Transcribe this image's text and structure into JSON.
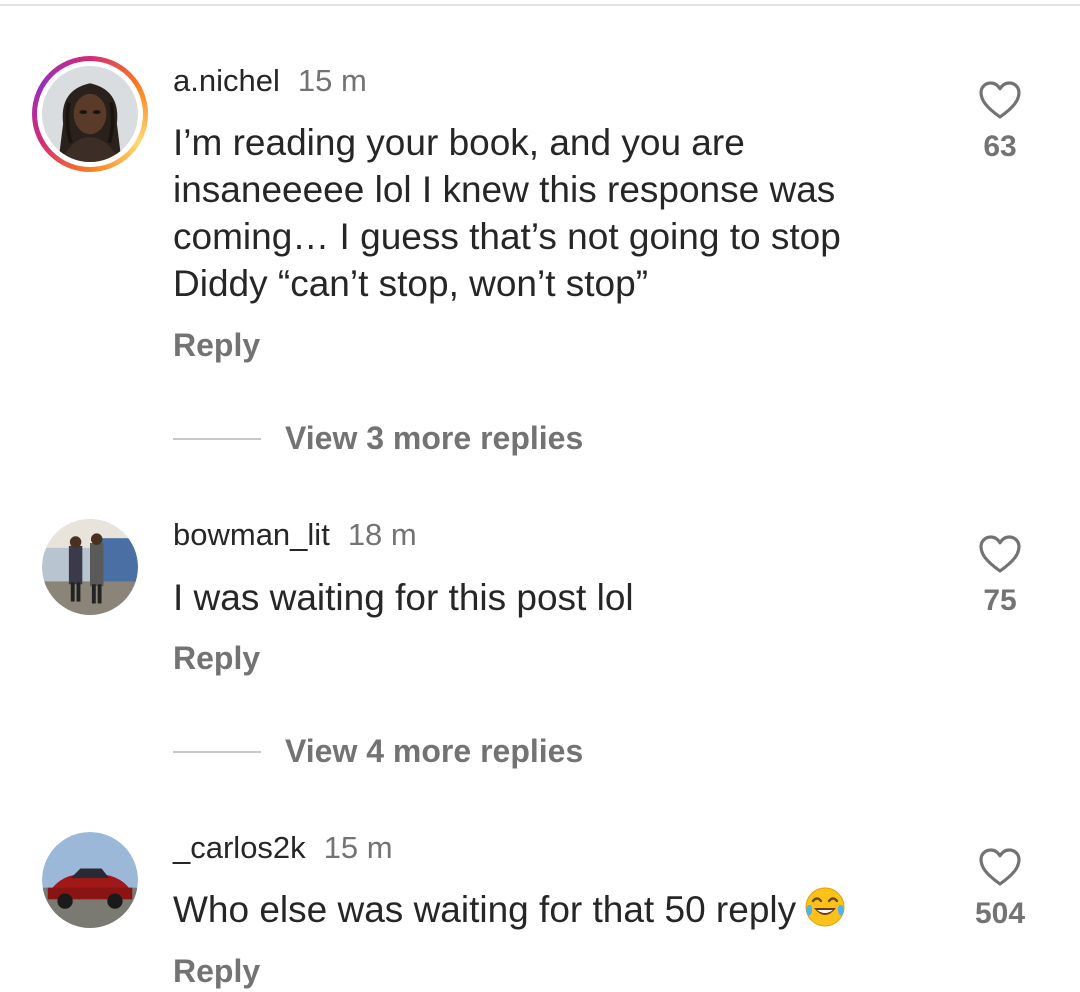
{
  "comments": [
    {
      "username": "a.nichel",
      "time": "15 m",
      "text": "I’m reading your book, and you are insaneeeee lol I knew this response was coming… I guess that’s not going to stop Diddy “can’t stop, won’t stop”",
      "reply_label": "Reply",
      "likes": "63",
      "view_replies": "View 3 more replies",
      "avatar_icon": "profile-photo-woman",
      "has_story_ring": true
    },
    {
      "username": "bowman_lit",
      "time": "18 m",
      "text": "I was waiting for this post lol",
      "reply_label": "Reply",
      "likes": "75",
      "view_replies": "View 4 more replies",
      "avatar_icon": "profile-photo-street",
      "has_story_ring": false
    },
    {
      "username": "_carlos2k",
      "time": "15 m",
      "text": "Who else was waiting for that 50 reply",
      "emoji": "tears-of-joy-emoji",
      "reply_label": "Reply",
      "likes": "504",
      "avatar_icon": "profile-photo-red-car",
      "has_story_ring": false
    }
  ],
  "colors": {
    "text": "#262626",
    "secondary": "#737373",
    "divider": "#c7c7c7"
  }
}
